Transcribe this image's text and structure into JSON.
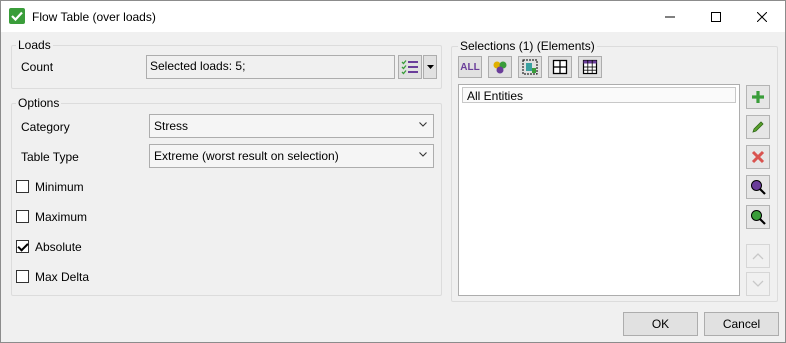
{
  "window": {
    "title": "Flow Table (over loads)"
  },
  "loads": {
    "group_label": "Loads",
    "count_label": "Count",
    "count_value": "Selected loads: 5;"
  },
  "options": {
    "group_label": "Options",
    "category_label": "Category",
    "category_value": "Stress",
    "table_type_label": "Table Type",
    "table_type_value": "Extreme (worst result on selection)",
    "checkboxes": [
      {
        "label": "Minimum",
        "checked": false
      },
      {
        "label": "Maximum",
        "checked": false
      },
      {
        "label": "Absolute",
        "checked": true
      },
      {
        "label": "Max Delta",
        "checked": false
      }
    ]
  },
  "selections": {
    "label": "Selections (1) (Elements)",
    "all_button": "ALL",
    "items": [
      "All Entities"
    ]
  },
  "footer": {
    "ok_label": "OK",
    "cancel_label": "Cancel"
  },
  "colors": {
    "accent_green": "#3a9d3a",
    "delete_red": "#d9534f",
    "zoom_purple": "#6a3d9a"
  }
}
